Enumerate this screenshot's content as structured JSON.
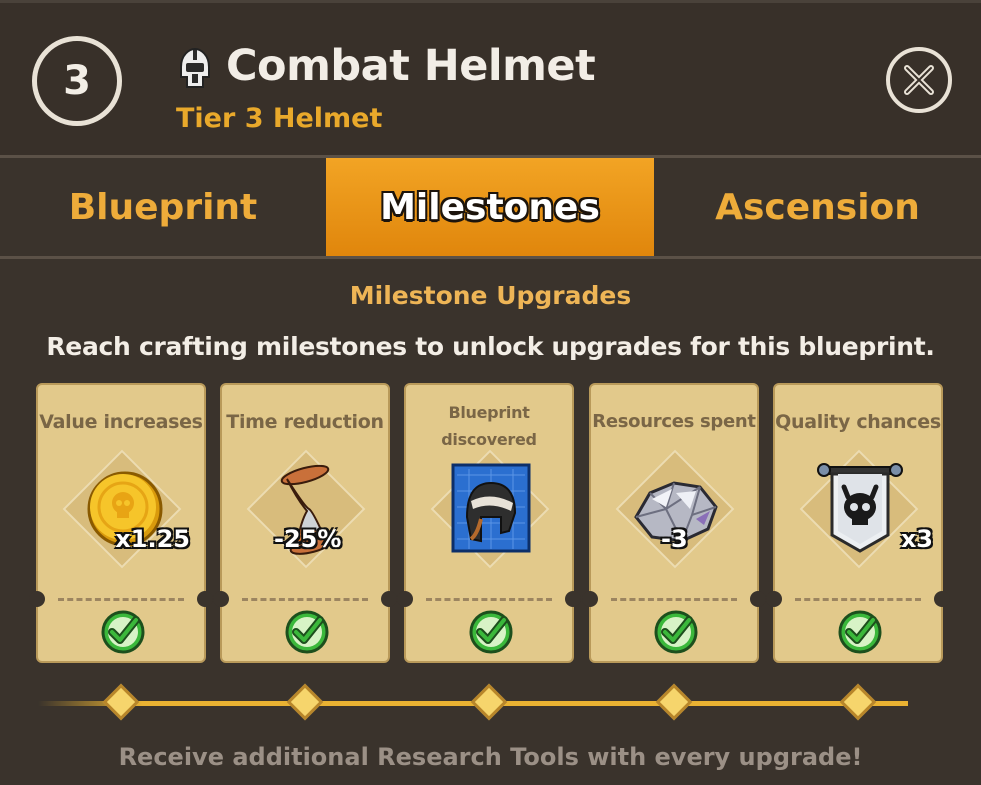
{
  "header": {
    "tier_number": "3",
    "title": "Combat Helmet",
    "subtitle": "Tier 3 Helmet",
    "title_icon": "helmet-icon",
    "close_icon": "close-icon"
  },
  "tabs": [
    {
      "label": "Blueprint",
      "active": false
    },
    {
      "label": "Milestones",
      "active": true
    },
    {
      "label": "Ascension",
      "active": false
    }
  ],
  "milestones": {
    "title": "Milestone Upgrades",
    "description": "Reach crafting milestones to unlock upgrades for this blueprint.",
    "cards": [
      {
        "label": "Value increases",
        "value": "x1.25",
        "icon": "gold-coin-icon",
        "completed": true
      },
      {
        "label": "Time reduction",
        "value": "-25%",
        "icon": "hourglass-icon",
        "completed": true
      },
      {
        "label": "Blueprint discovered",
        "value": "",
        "icon": "blueprint-helmet-icon",
        "completed": true
      },
      {
        "label": "Resources spent",
        "value": "-3",
        "icon": "ore-icon",
        "completed": true
      },
      {
        "label": "Quality chances",
        "value": "x3",
        "icon": "skull-banner-icon",
        "completed": true
      }
    ],
    "footer": "Receive additional Research Tools with every upgrade!"
  },
  "colors": {
    "accent": "#e9a92b",
    "tab_active": "#f2a424",
    "card_bg": "#e2c98b",
    "panel_bg": "#3a332c",
    "check_green": "#3bb83b"
  }
}
